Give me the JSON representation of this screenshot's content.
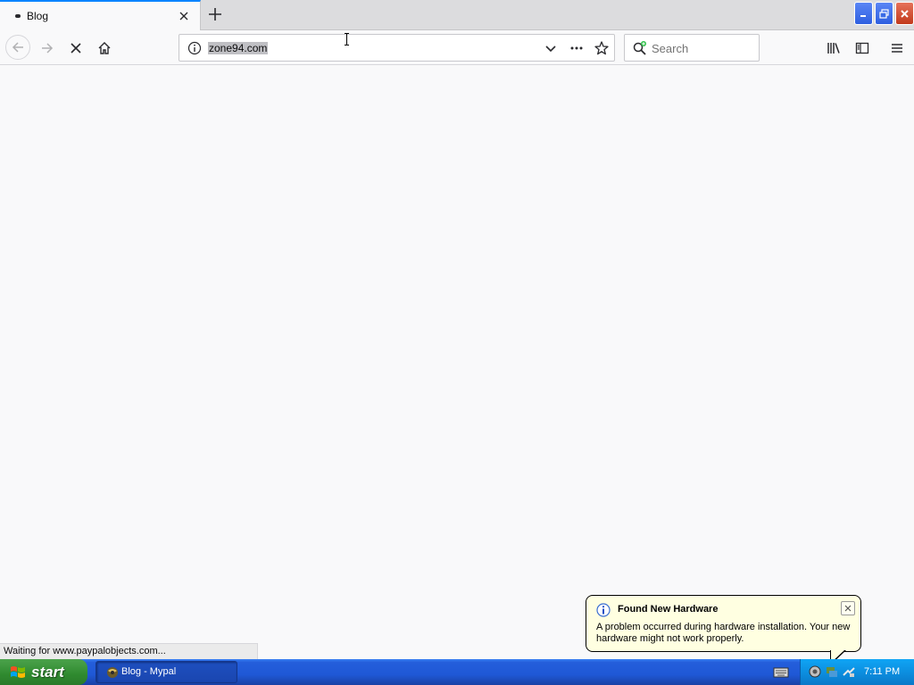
{
  "tab": {
    "title": "Blog"
  },
  "navbar": {
    "url": "zone94.com",
    "search_placeholder": "Search"
  },
  "status": {
    "text": "Waiting for www.paypalobjects.com..."
  },
  "balloon": {
    "title": "Found New Hardware",
    "text": "A problem occurred during hardware installation. Your new hardware might not work properly."
  },
  "taskbar": {
    "start_label": "start",
    "items": [
      {
        "label": "Blog - Mypal"
      }
    ],
    "clock": "7:11 PM"
  },
  "colors": {
    "accent": "#0a84ff",
    "balloon_bg": "#ffffe1",
    "taskbar_blue": "#245edb",
    "start_green": "#3c9a3c"
  },
  "icons": [
    "close-icon",
    "plus-icon",
    "minimize-icon",
    "restore-icon",
    "back-arrow-icon",
    "forward-arrow-icon",
    "stop-icon",
    "home-icon",
    "info-icon",
    "chevron-down-icon",
    "more-icon",
    "star-icon",
    "search-icon",
    "library-icon",
    "sidebar-icon",
    "menu-icon",
    "windows-flag-icon",
    "mypal-icon",
    "keyboard-icon"
  ]
}
